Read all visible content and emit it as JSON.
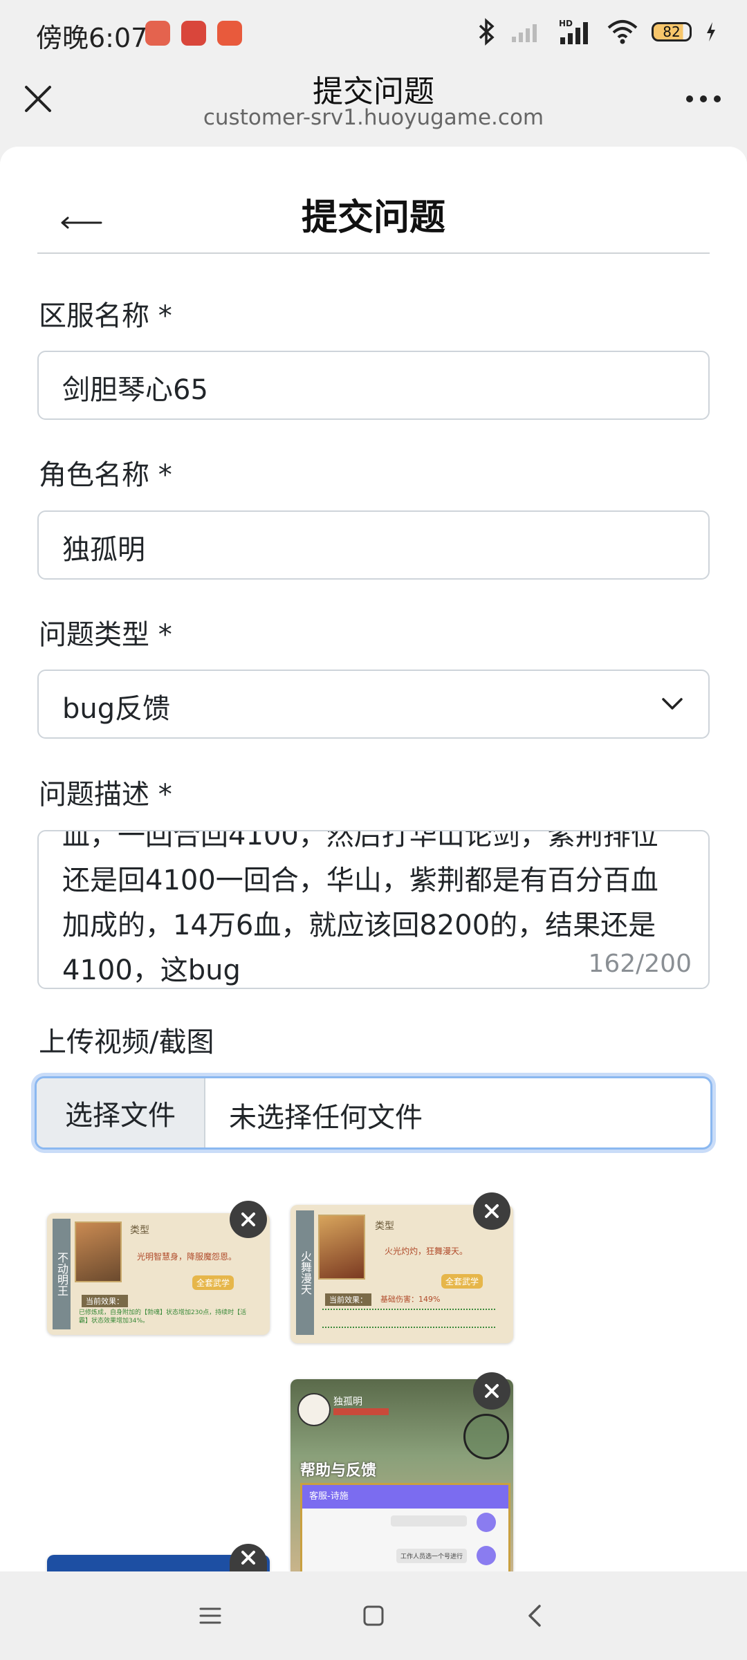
{
  "status": {
    "time": "傍晚6:07",
    "battery": "82",
    "hd": "HD"
  },
  "titlebar": {
    "title": "提交问题",
    "domain": "customer-srv1.huoyugame.com"
  },
  "page": {
    "heading": "提交问题"
  },
  "form": {
    "server_label": "区服名称 *",
    "server_value": "剑胆琴心65",
    "role_label": "角色名称 *",
    "role_value": "独孤明",
    "type_label": "问题类型 *",
    "type_value": "bug反馈",
    "desc_label": "问题描述 *",
    "desc_value": "血，一回合回4100，然后打华山论剑，紫荆排位还是回4100一回合，华山，紫荆都是有百分百血加成的，14万6血，就应该回8200的，结果还是4100，这bug",
    "desc_counter": "162/200",
    "upload_label": "上传视频/截图",
    "choose_file": "选择文件",
    "no_file": "未选择任何文件"
  },
  "thumbnails": [
    {
      "banner": "不动明王",
      "type": "类型",
      "desc": "光明智慧身，降服魔怨恩。",
      "tag": "全套武学",
      "effect": "当前效果：",
      "note": "已修炼成，自身附加的【勃魂】状态增加230点，持续时【活霸】状态效果增加34%。"
    },
    {
      "banner": "火舞漫天",
      "type": "类型",
      "desc": "火光灼灼，狂舞漫天。",
      "tag": "全套武学",
      "effect": "当前效果：",
      "stat": "基础伤害：149%"
    },
    {
      "name": "独孤明",
      "title": "帮助与反馈",
      "bar": "客服-诗施",
      "msg": "工作人员选一个号进行"
    }
  ],
  "colors": {
    "accent": "#8bb8f0",
    "purple": "#7b6cf0"
  }
}
